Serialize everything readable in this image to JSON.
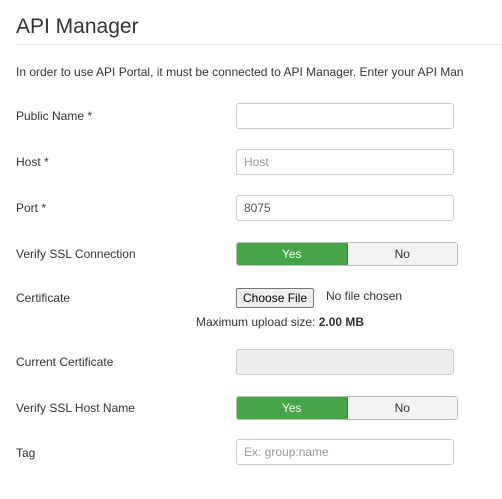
{
  "page": {
    "title": "API Manager",
    "intro": "In order to use API Portal, it must be connected to API Manager. Enter your API Man"
  },
  "fields": {
    "public_name": {
      "label": "Public Name *",
      "value": "",
      "placeholder": ""
    },
    "host": {
      "label": "Host *",
      "value": "",
      "placeholder": "Host"
    },
    "port": {
      "label": "Port *",
      "value": "8075",
      "placeholder": ""
    },
    "verify_ssl_connection": {
      "label": "Verify SSL Connection",
      "yes": "Yes",
      "no": "No",
      "selected": "Yes"
    },
    "certificate": {
      "label": "Certificate",
      "button": "Choose File",
      "status": "No file chosen",
      "upload_prefix": "Maximum upload size:",
      "upload_size": "2.00 MB"
    },
    "current_certificate": {
      "label": "Current Certificate",
      "value": ""
    },
    "verify_ssl_host_name": {
      "label": "Verify SSL Host Name",
      "yes": "Yes",
      "no": "No",
      "selected": "Yes"
    },
    "tag": {
      "label": "Tag",
      "value": "",
      "placeholder": "Ex: group:name"
    }
  },
  "colors": {
    "toggle_active": "#46a546",
    "disabled_field": "#eeeeee"
  }
}
